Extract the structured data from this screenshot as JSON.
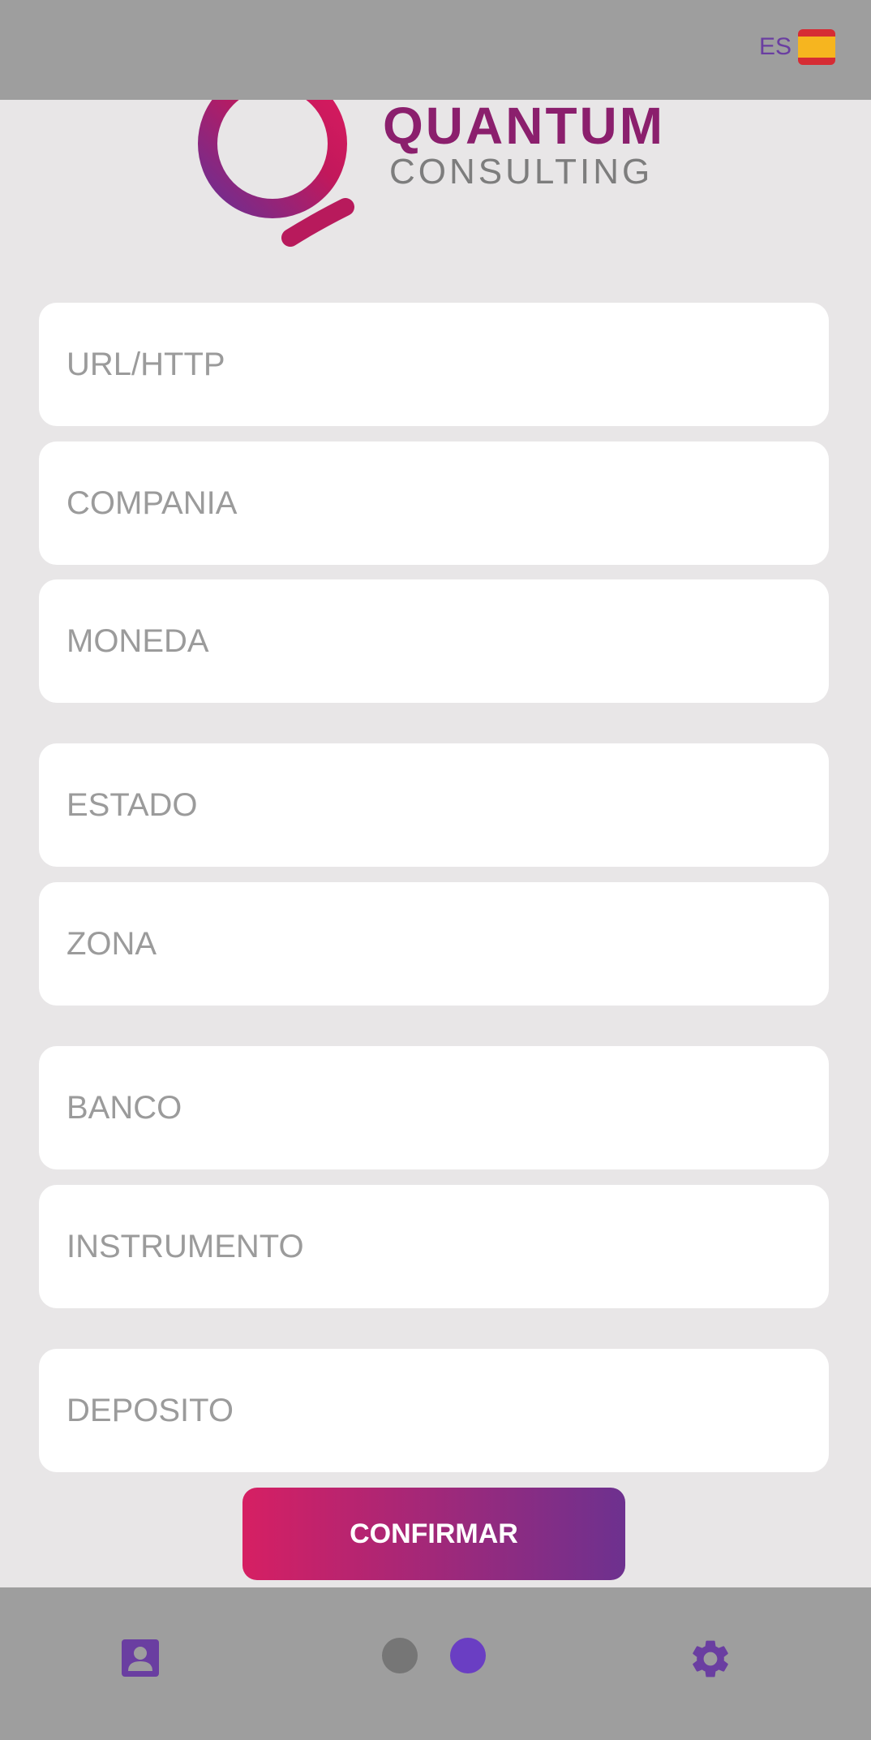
{
  "header": {
    "language_code": "ES",
    "flag_icon": "spain-flag-icon"
  },
  "logo": {
    "line1": "QUANTUM",
    "line2": "CONSULTING"
  },
  "form": {
    "url_placeholder": "URL/HTTP",
    "company_placeholder": "COMPANIA",
    "currency_placeholder": "MONEDA",
    "state_placeholder": "ESTADO",
    "zone_placeholder": "ZONA",
    "bank_placeholder": "BANCO",
    "instrument_placeholder": "INSTRUMENTO",
    "deposit_placeholder": "DEPOSITO",
    "confirm_label": "CONFIRMAR"
  },
  "bottom_nav": {
    "left_icon": "profile-card-icon",
    "right_icon": "gear-icon",
    "page_indicator": {
      "pages": 2,
      "active": 2
    }
  },
  "colors": {
    "accent_purple": "#6a3ea1",
    "gradient_start": "#d61f63",
    "gradient_end": "#6d318f",
    "bar_gray": "#9e9e9e",
    "background": "#e8e6e7"
  }
}
